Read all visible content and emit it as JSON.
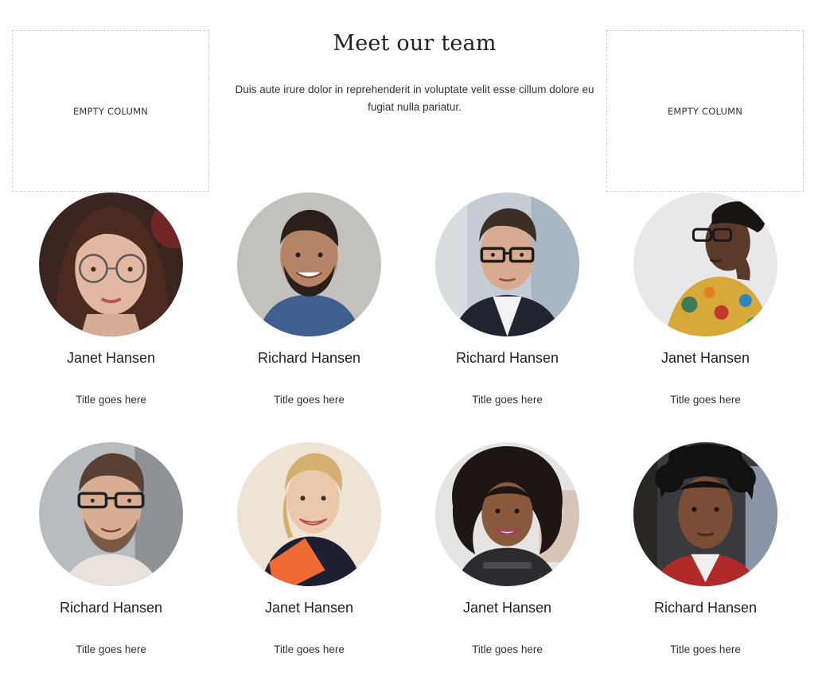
{
  "header": {
    "title": "Meet our team",
    "description": "Duis aute irure dolor in reprehenderit in voluptate velit esse cillum dolore eu fugiat nulla pariatur."
  },
  "placeholders": {
    "left": "EMPTY COLUMN",
    "right": "EMPTY COLUMN"
  },
  "team": [
    {
      "name": "Janet Hansen",
      "title": "Title goes here"
    },
    {
      "name": "Richard Hansen",
      "title": "Title goes here"
    },
    {
      "name": "Richard Hansen",
      "title": "Title goes here"
    },
    {
      "name": "Janet Hansen",
      "title": "Title goes here"
    },
    {
      "name": "Richard Hansen",
      "title": "Title goes here"
    },
    {
      "name": "Janet Hansen",
      "title": "Title goes here"
    },
    {
      "name": "Janet Hansen",
      "title": "Title goes here"
    },
    {
      "name": "Richard Hansen",
      "title": "Title goes here"
    }
  ]
}
